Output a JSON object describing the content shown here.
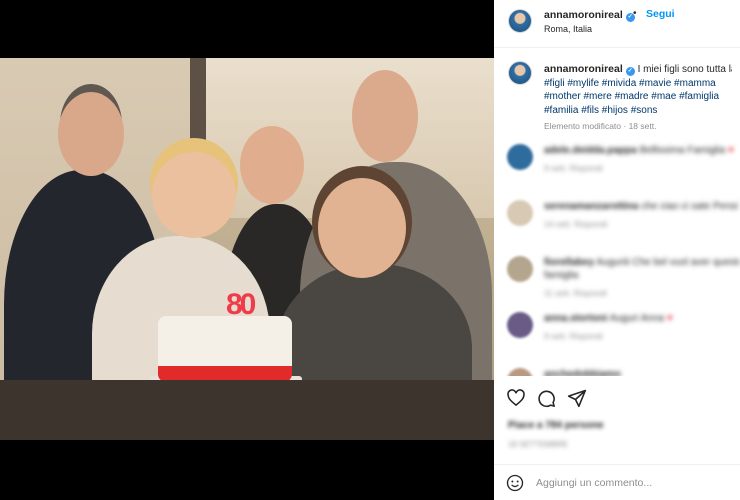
{
  "post": {
    "username": "annamoronireal",
    "follow_label": "Segui",
    "dot": "•",
    "location": "Roma, Italia"
  },
  "caption": {
    "username": "annamoronireal",
    "text": "I miei figli sono tutta la",
    "hashtags": "#figli #mylife #mivida #mavie #mamma #mother #mere #madre #mae #famiglia #familia #fils #hijos #sons",
    "meta": "Elemento modificato · 18 sett."
  },
  "comments": [
    {
      "user": "adele.deidda.pappa",
      "text": "Bellissima Famiglia",
      "meta": "9 sett.   Rispondi",
      "heart": "♥",
      "avatar_color": "#2f6c9e"
    },
    {
      "user": "serenamanzarottina",
      "text": "che ciao ci sate Pensi",
      "meta": "14 sett.   Rispondi",
      "heart": "",
      "avatar_color": "#d8c9b4"
    },
    {
      "user": "fiorellabey",
      "text": "Auguriii Che bel vuol aver questo",
      "text2": "famiglia",
      "meta": "11 sett.   Rispondi",
      "heart": "♥",
      "avatar_color": "#b4a58e"
    },
    {
      "user": "anna.stortoni",
      "text": "Auguri Anna",
      "meta": "9 sett.   Rispondi",
      "heart": "♥",
      "avatar_color": "#6a5a86"
    },
    {
      "user": "anchedobbiamo",
      "text": "",
      "meta": "",
      "heart": "",
      "avatar_color": "#b99982"
    }
  ],
  "likes": "Piace a 784 persone",
  "date": "18 SETTEMBRE",
  "add_comment_placeholder": "Aggiungi un commento...",
  "photo": {
    "candle_number": "80"
  },
  "icons": {
    "verified": "✓",
    "heart": "heart-icon",
    "comment": "comment-icon",
    "share": "share-icon",
    "emoji": "emoji-icon"
  },
  "colors": {
    "link": "#0095f6",
    "hashtag": "#00376b",
    "muted": "#8e8e8e",
    "verified": "#3897f0"
  }
}
